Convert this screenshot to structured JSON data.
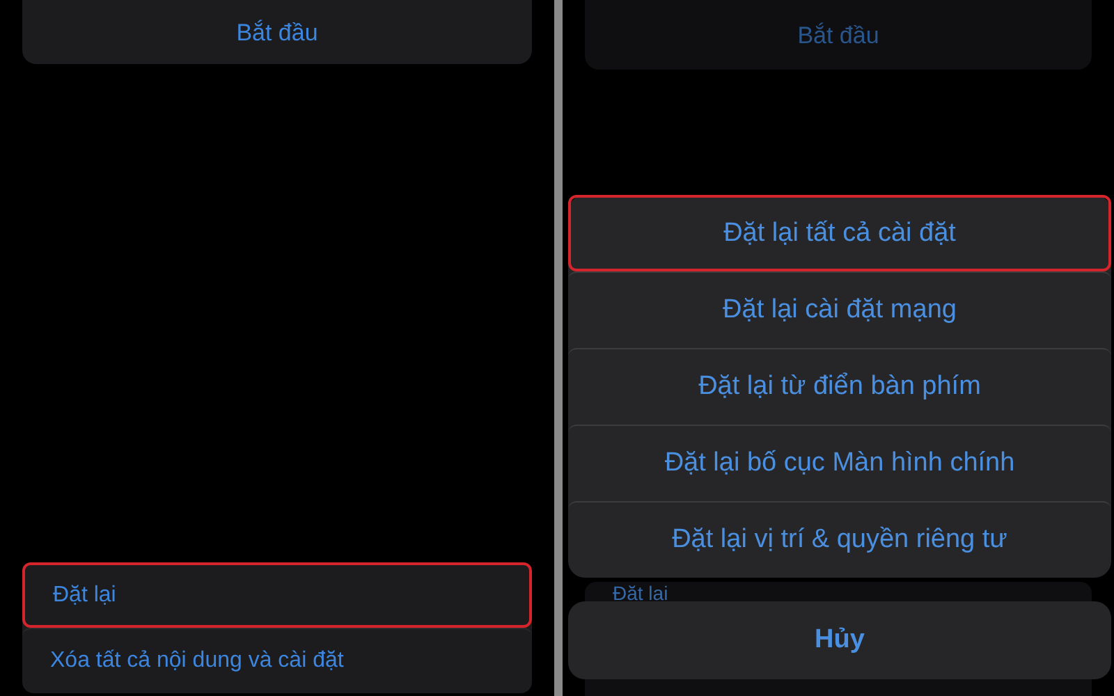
{
  "left_screen": {
    "top_card": {
      "button": "Bắt đầu"
    },
    "reset_group": {
      "items": [
        {
          "label": "Đặt lại",
          "selected": true
        },
        {
          "label": "Xóa tất cả nội dung và cài đặt",
          "selected": false
        }
      ]
    }
  },
  "right_screen": {
    "background": {
      "top_card_button": "Bắt đầu",
      "partial_row": "Đặt lại"
    },
    "action_sheet": {
      "options": [
        {
          "label": "Đặt lại tất cả cài đặt",
          "selected": true
        },
        {
          "label": "Đặt lại cài đặt mạng",
          "selected": false
        },
        {
          "label": "Đặt lại từ điển bàn phím",
          "selected": false
        },
        {
          "label": "Đặt lại bố cục Màn hình chính",
          "selected": false
        },
        {
          "label": "Đặt lại vị trí & quyền riêng tư",
          "selected": false
        }
      ],
      "cancel": "Hủy"
    }
  }
}
